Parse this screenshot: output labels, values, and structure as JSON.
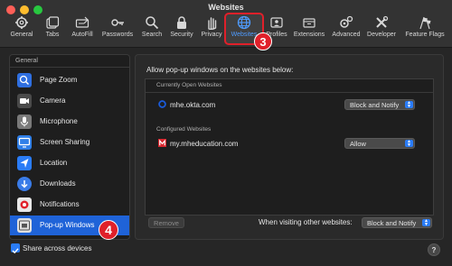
{
  "window": {
    "title": "Websites"
  },
  "toolbar": {
    "items": [
      {
        "label": "General",
        "icon": "gear-icon"
      },
      {
        "label": "Tabs",
        "icon": "tabs-icon"
      },
      {
        "label": "AutoFill",
        "icon": "autofill-icon"
      },
      {
        "label": "Passwords",
        "icon": "key-icon"
      },
      {
        "label": "Search",
        "icon": "magnifier-icon"
      },
      {
        "label": "Security",
        "icon": "lock-icon"
      },
      {
        "label": "Privacy",
        "icon": "hand-icon"
      },
      {
        "label": "Websites",
        "icon": "globe-icon",
        "active": true
      },
      {
        "label": "Profiles",
        "icon": "profile-icon"
      },
      {
        "label": "Extensions",
        "icon": "puzzle-icon"
      },
      {
        "label": "Advanced",
        "icon": "gears-icon"
      },
      {
        "label": "Developer",
        "icon": "wrench-icon"
      },
      {
        "label": "Feature Flags",
        "icon": "flags-icon"
      }
    ]
  },
  "annotations": {
    "step_toolbar": "3",
    "step_sidebar": "4"
  },
  "sidebar": {
    "header": "General",
    "items": [
      {
        "label": "Page Zoom",
        "icon": "zoom-icon",
        "color": "#2f6fe0"
      },
      {
        "label": "Camera",
        "icon": "camera-icon",
        "color": "#5a5a5a"
      },
      {
        "label": "Microphone",
        "icon": "microphone-icon",
        "color": "#8a8a8a"
      },
      {
        "label": "Screen Sharing",
        "icon": "screen-icon",
        "color": "#2f7fe8"
      },
      {
        "label": "Location",
        "icon": "location-icon",
        "color": "#2a7cf7"
      },
      {
        "label": "Downloads",
        "icon": "download-icon",
        "color": "#3a7ce8"
      },
      {
        "label": "Notifications",
        "icon": "bell-icon",
        "color": "#e8e8e8"
      },
      {
        "label": "Pop-up Windows",
        "icon": "popup-icon",
        "color": "#e0e0e0",
        "selected": true
      }
    ],
    "share_label": "Share across devices",
    "share_checked": true
  },
  "main": {
    "description": "Allow pop-up windows on the websites below:",
    "sections": [
      {
        "title": "Currently Open Websites",
        "sites": [
          {
            "name": "mhe.okta.com",
            "icon": "okta-icon",
            "setting": "Block and Notify"
          }
        ]
      },
      {
        "title": "Configured Websites",
        "sites": [
          {
            "name": "my.mheducation.com",
            "icon": "mheducation-icon",
            "setting": "Allow"
          }
        ]
      }
    ],
    "remove_label": "Remove",
    "other_label": "When visiting other websites:",
    "other_setting": "Block and Notify"
  },
  "help_label": "?",
  "colors": {
    "accent": "#2a7cf7",
    "annotation": "#e0202a",
    "selection": "#1f63d8"
  }
}
